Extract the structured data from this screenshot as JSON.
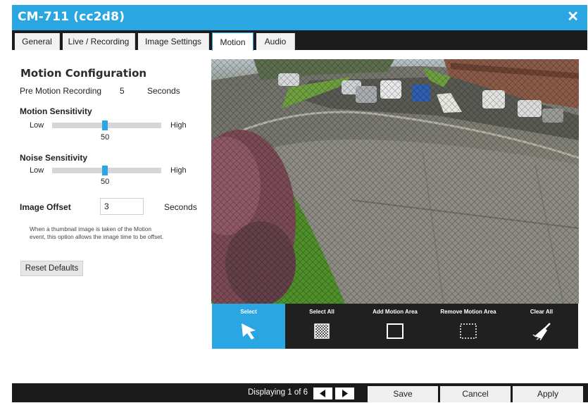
{
  "window": {
    "title": "CM-711 (cc2d8)",
    "close_label": "✕"
  },
  "tabs": [
    {
      "label": "General"
    },
    {
      "label": "Live / Recording"
    },
    {
      "label": "Image Settings"
    },
    {
      "label": "Motion",
      "active": true
    },
    {
      "label": "Audio"
    }
  ],
  "motion": {
    "heading": "Motion Configuration",
    "pre_motion": {
      "label": "Pre Motion Recording",
      "value": "5",
      "unit": "Seconds"
    },
    "motion_sensitivity": {
      "label": "Motion Sensitivity",
      "low": "Low",
      "high": "High",
      "value": "50"
    },
    "noise_sensitivity": {
      "label": "Noise Sensitivity",
      "low": "Low",
      "high": "High",
      "value": "50"
    },
    "image_offset": {
      "label": "Image Offset",
      "value": "3",
      "unit": "Seconds"
    },
    "help_text": "When a thumbnail image is taken of the Motion event, this option allows the image time to be offset.",
    "reset_label": "Reset Defaults"
  },
  "tools": [
    {
      "label": "Select",
      "icon": "cursor-arrow-icon",
      "active": true
    },
    {
      "label": "Select All",
      "icon": "grid-pattern-icon"
    },
    {
      "label": "Add Motion Area",
      "icon": "square-outline-icon"
    },
    {
      "label": "Remove Motion Area",
      "icon": "dashed-square-icon"
    },
    {
      "label": "Clear All",
      "icon": "broom-icon"
    }
  ],
  "footer": {
    "displaying": "Displaying 1 of 6",
    "prev_icon": "triangle-left-icon",
    "next_icon": "triangle-right-icon",
    "save_label": "Save",
    "cancel_label": "Cancel",
    "apply_label": "Apply"
  },
  "colors": {
    "accent": "#2aa7e2",
    "dark_bar": "#1c1c1c"
  }
}
